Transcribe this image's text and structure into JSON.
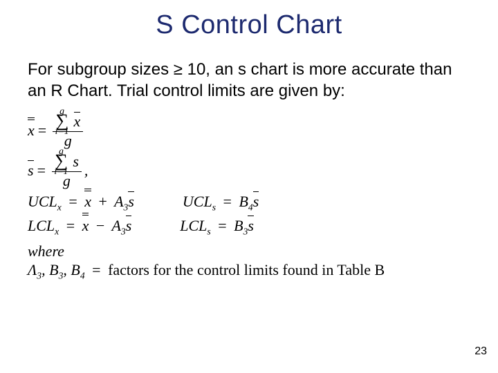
{
  "title": "S Control Chart",
  "paragraph": "For subgroup sizes ≥ 10, an s chart is more accurate than an R Chart. Trial control limits are given by:",
  "eq": {
    "xdd": "x",
    "equals": "=",
    "sum": "∑",
    "sum_upper_g": "g",
    "sum_lower_full": "i=1",
    "xbar": "x",
    "g": "g",
    "sbar": "s",
    "s": "s",
    "comma": ",",
    "ucl_x": "UCL",
    "ucl_x_sub": "x",
    "plus": "+",
    "minus": "−",
    "a3": "A",
    "a3_sub": "3",
    "lcl_x": "LCL",
    "lcl_x_sub": "x",
    "ucl_s": "UCL",
    "ucl_s_sub": "s",
    "b4": "B",
    "b4_sub": "4",
    "lcl_s": "LCL",
    "lcl_s_sub": "s",
    "b3": "B",
    "b3_sub": "3",
    "where": "where",
    "lambda3": "Λ",
    "lambda3_sub": "3",
    "factors_text": "factors for the control limits found in Table B"
  },
  "page_number": "23"
}
